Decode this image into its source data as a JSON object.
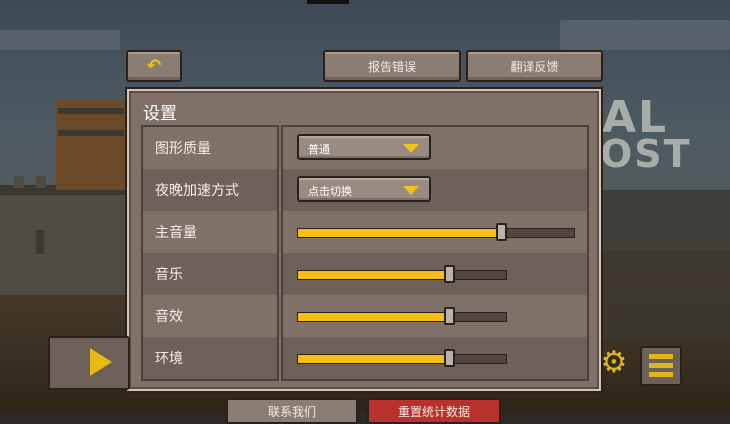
{
  "colors": {
    "accent": "#f5bf17",
    "panel": "#7f7168",
    "button": "#8c7d74",
    "danger_button": "#b8312c"
  },
  "top_bar": {
    "back_icon": "undo-arrow-icon",
    "back_glyph": "↶",
    "report_bug_label": "报告错误",
    "translation_feedback_label": "翻译反馈"
  },
  "settings": {
    "title": "设置",
    "rows": [
      {
        "label": "图形质量",
        "type": "dropdown",
        "value": "普通"
      },
      {
        "label": "夜晚加速方式",
        "type": "dropdown",
        "value": "点击切换"
      },
      {
        "label": "主音量",
        "type": "slider",
        "value": 0.74
      },
      {
        "label": "音乐",
        "type": "slider",
        "value": 0.73
      },
      {
        "label": "音效",
        "type": "slider",
        "value": 0.73
      },
      {
        "label": "环境",
        "type": "slider",
        "value": 0.73
      }
    ]
  },
  "background": {
    "logo_line1": "AL",
    "logo_line2": "OST"
  },
  "bottom": {
    "play_icon": "play-icon",
    "settings_icon": "gear-icon",
    "menu_icon": "hamburger-menu-icon",
    "gear_glyph": "⚙",
    "contact_label": "联系我们",
    "reset_stats_label": "重置统计数据"
  }
}
